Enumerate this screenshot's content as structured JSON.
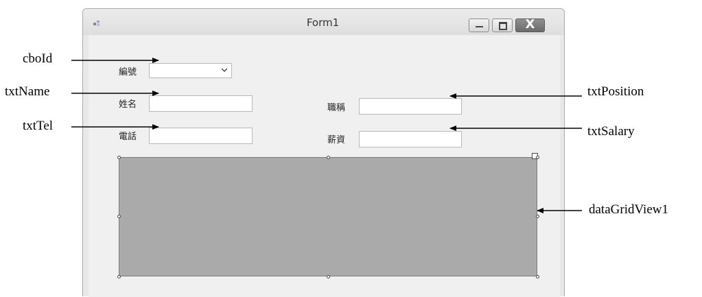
{
  "window": {
    "title": "Form1",
    "close_glyph": "X",
    "icon_names": [
      "app-icon",
      "minimize-icon",
      "maximize-icon",
      "close-icon"
    ]
  },
  "form": {
    "id_label": "編號",
    "name_label": "姓名",
    "tel_label": "電話",
    "position_label": "職稱",
    "salary_label": "薪資",
    "id_value": "",
    "name_value": "",
    "tel_value": "",
    "position_value": "",
    "salary_value": ""
  },
  "callouts": {
    "cboId": "cboId",
    "txtName": "txtName",
    "txtTel": "txtTel",
    "txtPosition": "txtPosition",
    "txtSalary": "txtSalary",
    "dataGridView1": "dataGridView1"
  },
  "colors": {
    "grid_fill": "#aaaaaa",
    "client_bg": "#f0f0f0",
    "close_button": "#7a7a7a"
  }
}
